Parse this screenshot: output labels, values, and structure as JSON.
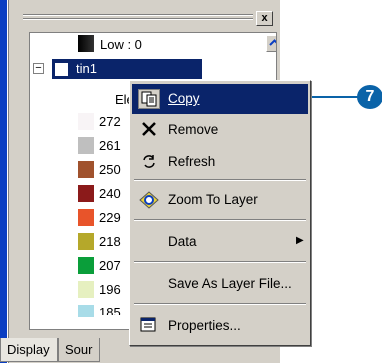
{
  "close_glyph": "x",
  "tree": {
    "low_label": "Low : 0",
    "layer_name": "tin1",
    "expander_glyph": "−",
    "elevation_label": "Ele",
    "classes": [
      {
        "label": "272",
        "color": "#f8f4f6"
      },
      {
        "label": "261",
        "color": "#bfbfbf"
      },
      {
        "label": "250",
        "color": "#a0522d"
      },
      {
        "label": "240",
        "color": "#8b1a1a"
      },
      {
        "label": "229",
        "color": "#e8542a"
      },
      {
        "label": "218",
        "color": "#b5a82a"
      },
      {
        "label": "207",
        "color": "#0a9e3a"
      },
      {
        "label": "196",
        "color": "#e6f0c0"
      },
      {
        "label": "185",
        "color": "#a8dce8"
      }
    ]
  },
  "tabs": {
    "display": "Display",
    "source": "Sour"
  },
  "menu": {
    "items": [
      {
        "label": "Copy",
        "icon": "copy-icon"
      },
      {
        "label": "Remove",
        "icon": "remove-x-icon"
      },
      {
        "label": "Refresh",
        "icon": "refresh-icon"
      },
      {
        "label": "Zoom To Layer",
        "icon": "zoom-to-layer-icon"
      },
      {
        "label": "Data",
        "icon": ""
      },
      {
        "label": "Save As Layer File...",
        "icon": ""
      },
      {
        "label": "Properties...",
        "icon": "properties-icon"
      }
    ],
    "submenu_arrow": "▶"
  },
  "callout": {
    "step": "7",
    "color": "#0a63a8"
  }
}
